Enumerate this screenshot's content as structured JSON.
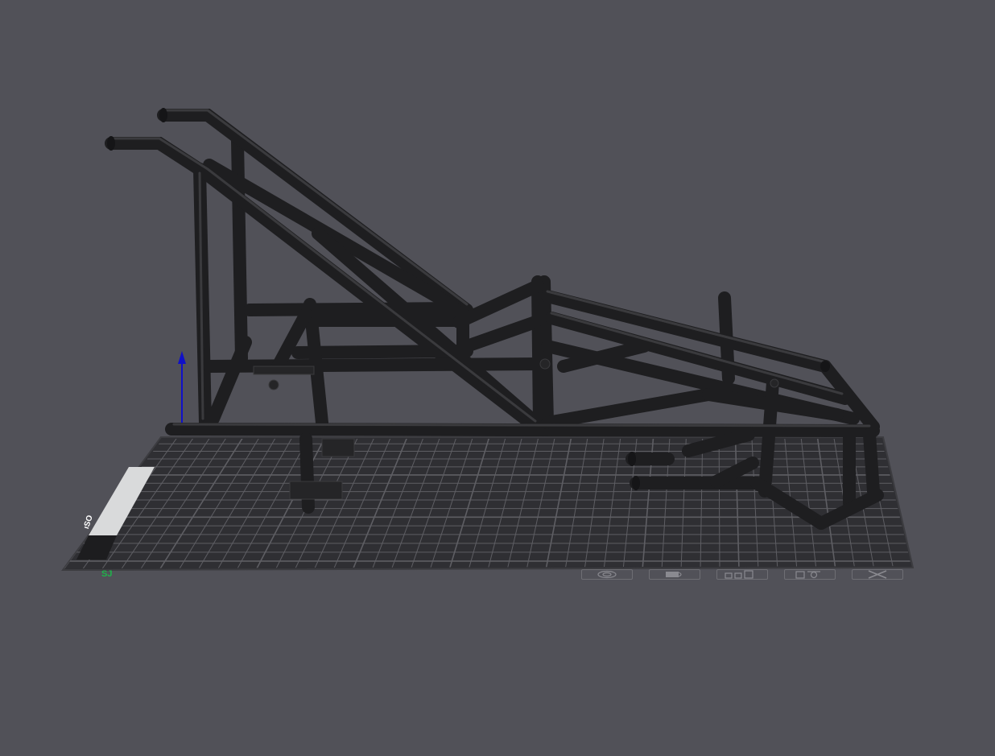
{
  "viewport": {
    "name": "3d-build-plate-view",
    "background_color": "#515158",
    "model_color": "#2a2a2c",
    "bed_color": "#2f2f33",
    "grid_color": "#6f6f75",
    "z_axis_color": "#1010c8"
  },
  "bed": {
    "brand_label": "ıSO",
    "axis_label": "SJ",
    "icons": [
      {
        "name": "target-icon"
      },
      {
        "name": "bed-texture-icon"
      },
      {
        "name": "layers-icon"
      },
      {
        "name": "nozzle-icon"
      },
      {
        "name": "cross-icon"
      }
    ]
  }
}
